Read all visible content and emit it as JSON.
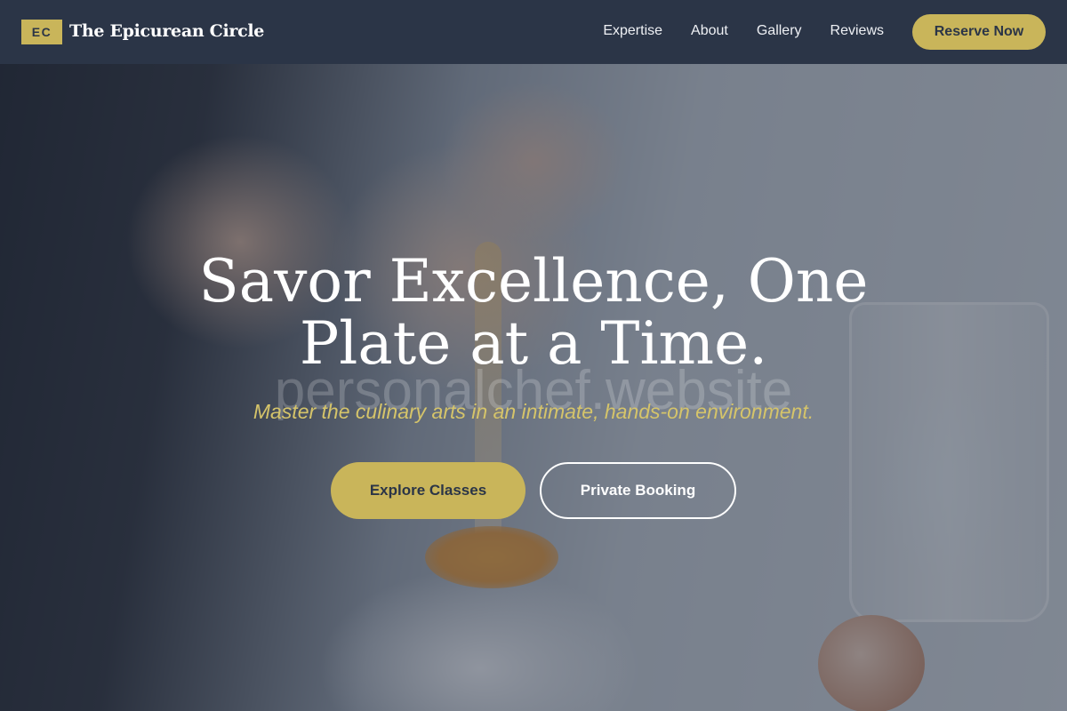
{
  "nav": {
    "logo_initials": "EC",
    "brand": "The Epicurean Circle",
    "links": [
      "Expertise",
      "About",
      "Gallery",
      "Reviews"
    ],
    "cta": "Reserve Now"
  },
  "hero": {
    "title_line1": "Savor Excellence, One",
    "title_line2": "Plate at a Time.",
    "watermark": "personalchef.website",
    "subtitle": "Master the culinary arts in an intimate, hands-on environment.",
    "primary_button": "Explore Classes",
    "secondary_button": "Private Booking",
    "background_image": "hands-cracking-egg-into-flour"
  },
  "colors": {
    "nav_bg": "#2b3547",
    "accent_gold": "#c9b55a",
    "subtitle_gold": "#d5c46a",
    "text_white": "#ffffff"
  }
}
